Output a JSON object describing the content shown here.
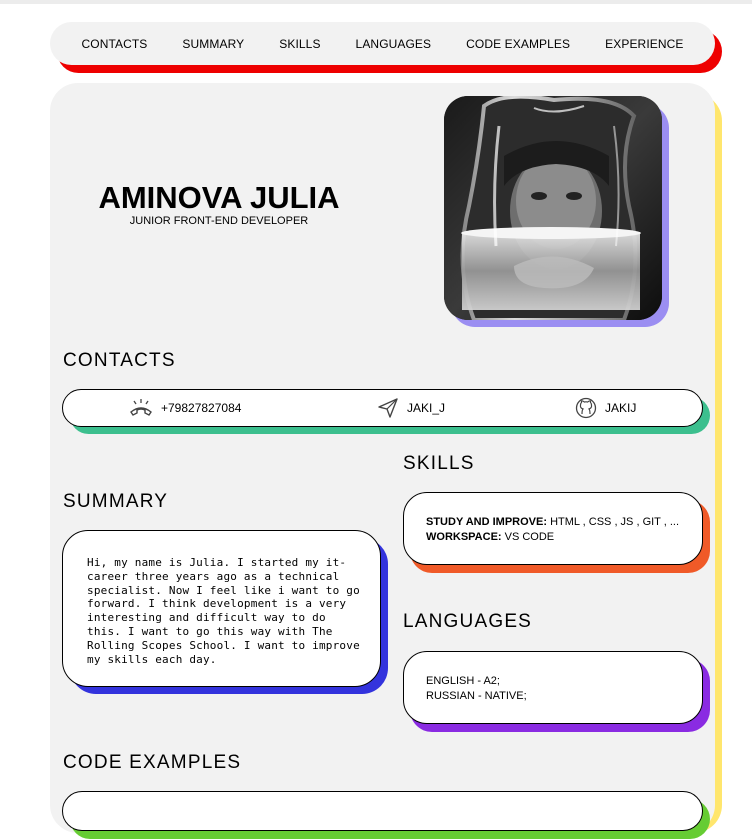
{
  "nav": {
    "items": [
      "CONTACTS",
      "SUMMARY",
      "SKILLS",
      "LANGUAGES",
      "CODE EXAMPLES",
      "EXPERIENCE"
    ]
  },
  "header": {
    "name": "AMINOVA JULIA",
    "role": "JUNIOR FRONT-END DEVELOPER"
  },
  "contacts": {
    "title": "CONTACTS",
    "phone": "+79827827084",
    "telegram": "JAKI_J",
    "github": "JAKIJ"
  },
  "summary": {
    "title": "SUMMARY",
    "text": "Hi, my name is Julia. I started my it-career three years ago as a technical specialist. Now I feel like i want to go forward. I think development is a very interesting and difficult way to do this. I want to go this way with The Rolling Scopes School. I want to improve my skills each day."
  },
  "skills": {
    "title": "SKILLS",
    "study_label": "STUDY AND IMPROVE:",
    "study_value": " HTML , CSS , JS , GIT , ...",
    "workspace_label": "WORKSPACE:",
    "workspace_value": " VS CODE"
  },
  "languages": {
    "title": "LANGUAGES",
    "items": [
      "ENGLISH - A2;",
      "RUSSIAN - NATIVE;"
    ]
  },
  "code_examples": {
    "title": "CODE EXAMPLES"
  },
  "colors": {
    "nav_shadow": "#ee0000",
    "card_border": "#ffe66d",
    "photo_shadow": "#9b8ef2",
    "contacts_shadow": "#3cbf8e",
    "summary_shadow": "#3333dd",
    "skills_shadow": "#f05a28",
    "languages_shadow": "#8a2be2",
    "code_shadow": "#66cc33"
  }
}
